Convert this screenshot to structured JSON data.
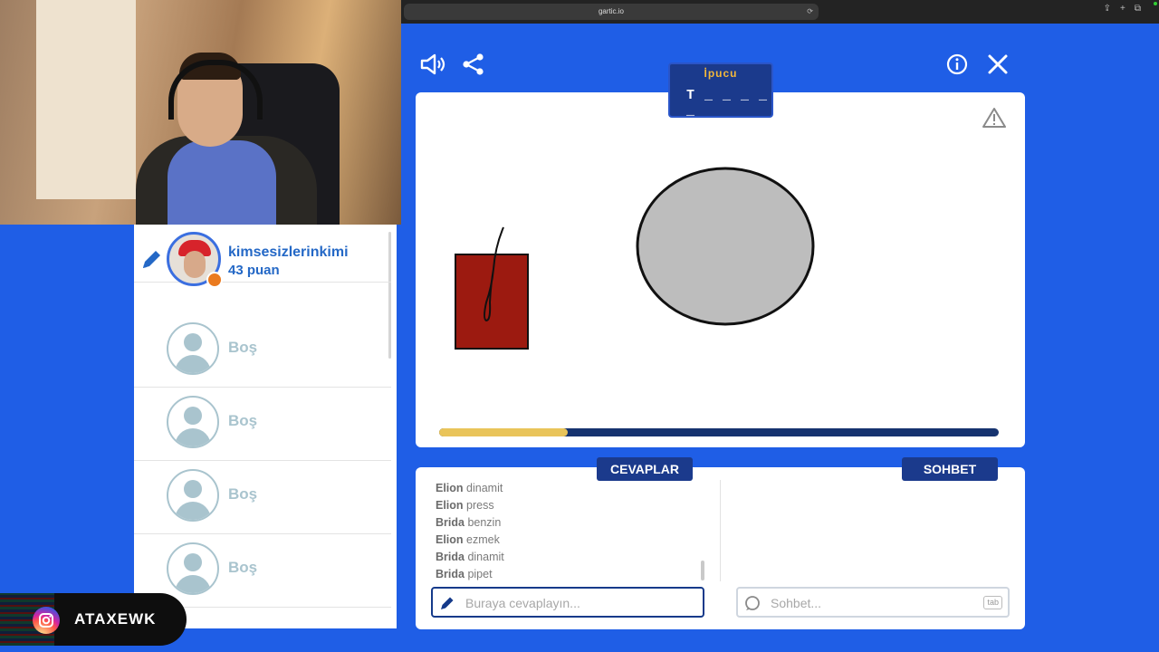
{
  "browser": {
    "url": "gartic.io"
  },
  "streamer": {
    "instagram_handle": "ATAXEWK"
  },
  "toolbar": {
    "sound_icon": "speaker-icon",
    "share_icon": "share-icon",
    "info_icon": "info-icon",
    "close_icon": "close-icon"
  },
  "hint": {
    "title": "İpucu",
    "pattern": "T _ _ _ _ _"
  },
  "players": {
    "current": {
      "name": "kimsesizlerinkimi",
      "score": "43 puan"
    },
    "empty_slots": [
      "Boş",
      "Boş",
      "Boş",
      "Boş"
    ]
  },
  "round": {
    "time_remaining_fraction": 0.23
  },
  "answers": {
    "title": "CEVAPLAR",
    "items": [
      {
        "user": "Elion",
        "text": "dinamit"
      },
      {
        "user": "Elion",
        "text": "press"
      },
      {
        "user": "Brida",
        "text": "benzin"
      },
      {
        "user": "Elion",
        "text": "ezmek"
      },
      {
        "user": "Brida",
        "text": "dinamit"
      },
      {
        "user": "Brida",
        "text": "pipet"
      }
    ],
    "placeholder": "Buraya cevaplayın..."
  },
  "chat": {
    "title": "SOHBET",
    "placeholder": "Sohbet...",
    "shortcut": "tab"
  },
  "colors": {
    "background": "#1f5ee6",
    "navy": "#1b3a8c",
    "accent_yellow": "#e9c45a"
  }
}
